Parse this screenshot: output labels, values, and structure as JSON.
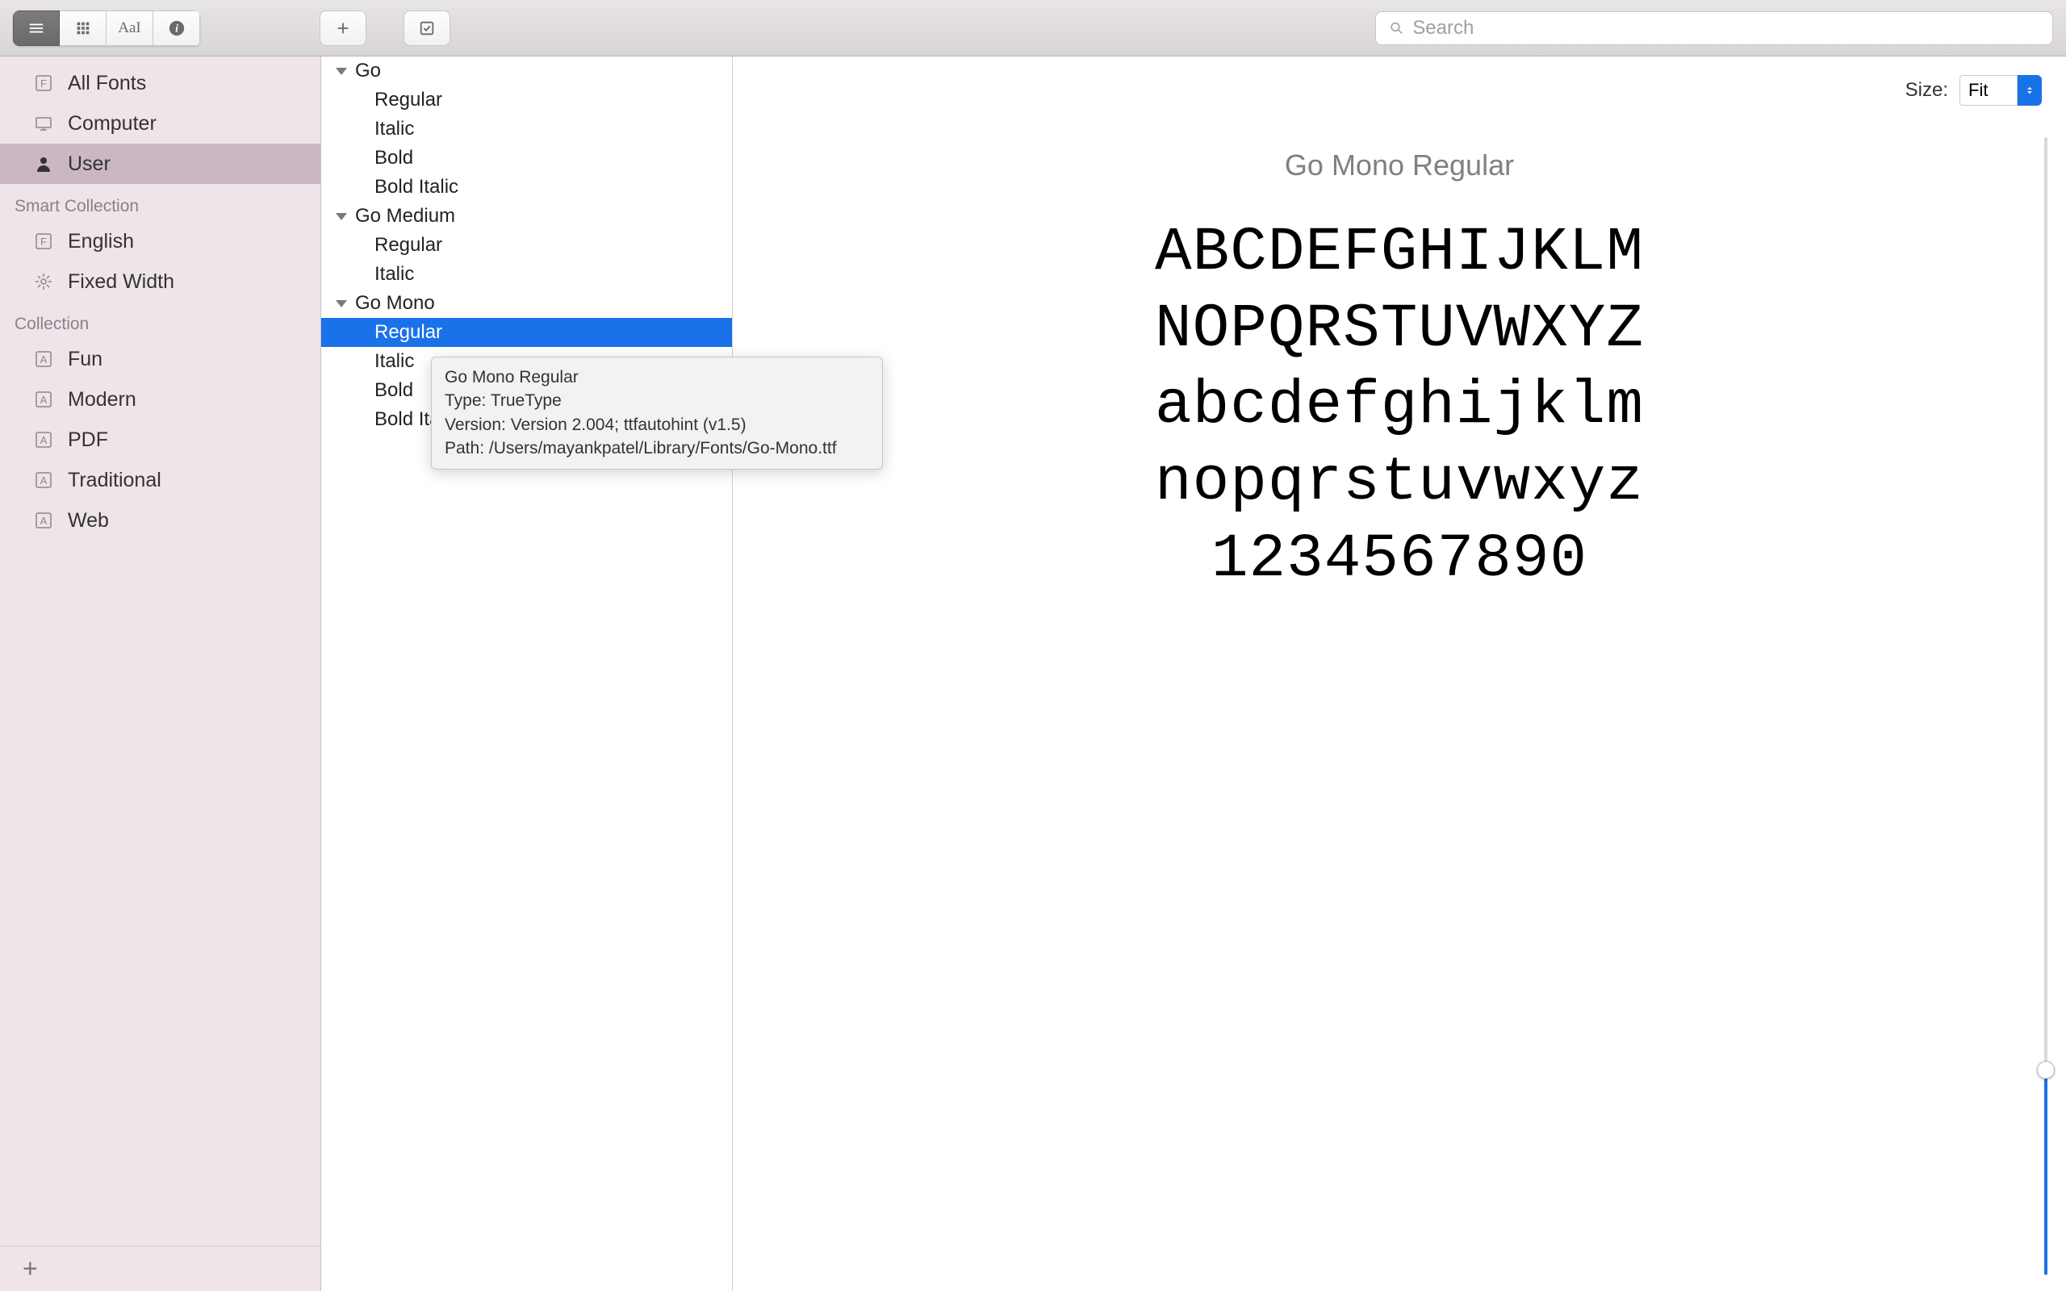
{
  "toolbar": {
    "search_placeholder": "Search"
  },
  "sidebar": {
    "top": [
      {
        "label": "All Fonts",
        "icon": "font-box"
      },
      {
        "label": "Computer",
        "icon": "computer"
      },
      {
        "label": "User",
        "icon": "user",
        "selected": true
      }
    ],
    "smart_header": "Smart Collection",
    "smart": [
      {
        "label": "English",
        "icon": "font-box"
      },
      {
        "label": "Fixed Width",
        "icon": "gear"
      }
    ],
    "collection_header": "Collection",
    "collections": [
      {
        "label": "Fun",
        "icon": "A-box"
      },
      {
        "label": "Modern",
        "icon": "A-box"
      },
      {
        "label": "PDF",
        "icon": "A-box"
      },
      {
        "label": "Traditional",
        "icon": "A-box"
      },
      {
        "label": "Web",
        "icon": "A-box"
      }
    ]
  },
  "families": [
    {
      "name": "Go",
      "styles": [
        "Regular",
        "Italic",
        "Bold",
        "Bold Italic"
      ]
    },
    {
      "name": "Go Medium",
      "styles": [
        "Regular",
        "Italic"
      ]
    },
    {
      "name": "Go Mono",
      "styles": [
        "Regular",
        "Italic",
        "Bold",
        "Bold Italic"
      ],
      "selected_style": "Regular"
    }
  ],
  "tooltip": {
    "name": "Go Mono Regular",
    "type_label": "Type: TrueType",
    "version": "Version: Version 2.004; ttfautohint (v1.5)",
    "path": "Path: /Users/mayankpatel/Library/Fonts/Go-Mono.ttf"
  },
  "preview": {
    "size_label": "Size:",
    "size_value": "Fit",
    "title": "Go Mono Regular",
    "lines": [
      "ABCDEFGHIJKLM",
      "NOPQRSTUVWXYZ",
      "abcdefghijklm",
      "nopqrstuvwxyz",
      "1234567890"
    ]
  }
}
